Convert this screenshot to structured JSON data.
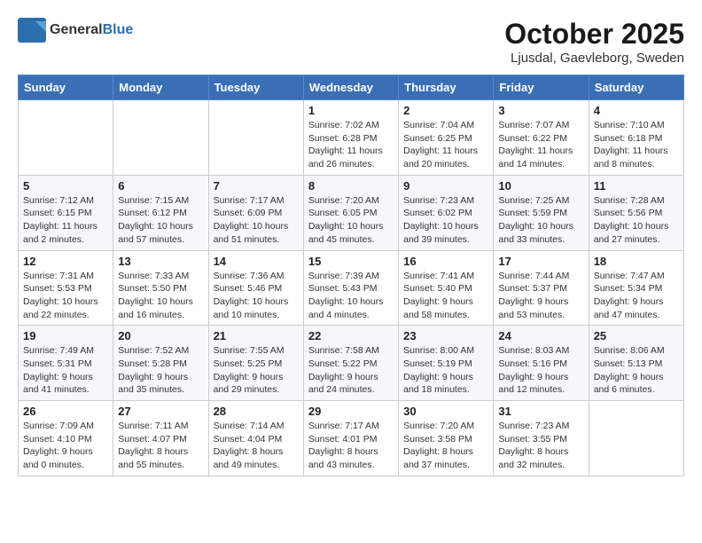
{
  "logo": {
    "general": "General",
    "blue": "Blue",
    "tagline": ""
  },
  "title": {
    "month_year": "October 2025",
    "location": "Ljusdal, Gaevleborg, Sweden"
  },
  "days_header": [
    "Sunday",
    "Monday",
    "Tuesday",
    "Wednesday",
    "Thursday",
    "Friday",
    "Saturday"
  ],
  "weeks": [
    [
      {
        "day": "",
        "content": ""
      },
      {
        "day": "",
        "content": ""
      },
      {
        "day": "",
        "content": ""
      },
      {
        "day": "1",
        "content": "Sunrise: 7:02 AM\nSunset: 6:28 PM\nDaylight: 11 hours\nand 26 minutes."
      },
      {
        "day": "2",
        "content": "Sunrise: 7:04 AM\nSunset: 6:25 PM\nDaylight: 11 hours\nand 20 minutes."
      },
      {
        "day": "3",
        "content": "Sunrise: 7:07 AM\nSunset: 6:22 PM\nDaylight: 11 hours\nand 14 minutes."
      },
      {
        "day": "4",
        "content": "Sunrise: 7:10 AM\nSunset: 6:18 PM\nDaylight: 11 hours\nand 8 minutes."
      }
    ],
    [
      {
        "day": "5",
        "content": "Sunrise: 7:12 AM\nSunset: 6:15 PM\nDaylight: 11 hours\nand 2 minutes."
      },
      {
        "day": "6",
        "content": "Sunrise: 7:15 AM\nSunset: 6:12 PM\nDaylight: 10 hours\nand 57 minutes."
      },
      {
        "day": "7",
        "content": "Sunrise: 7:17 AM\nSunset: 6:09 PM\nDaylight: 10 hours\nand 51 minutes."
      },
      {
        "day": "8",
        "content": "Sunrise: 7:20 AM\nSunset: 6:05 PM\nDaylight: 10 hours\nand 45 minutes."
      },
      {
        "day": "9",
        "content": "Sunrise: 7:23 AM\nSunset: 6:02 PM\nDaylight: 10 hours\nand 39 minutes."
      },
      {
        "day": "10",
        "content": "Sunrise: 7:25 AM\nSunset: 5:59 PM\nDaylight: 10 hours\nand 33 minutes."
      },
      {
        "day": "11",
        "content": "Sunrise: 7:28 AM\nSunset: 5:56 PM\nDaylight: 10 hours\nand 27 minutes."
      }
    ],
    [
      {
        "day": "12",
        "content": "Sunrise: 7:31 AM\nSunset: 5:53 PM\nDaylight: 10 hours\nand 22 minutes."
      },
      {
        "day": "13",
        "content": "Sunrise: 7:33 AM\nSunset: 5:50 PM\nDaylight: 10 hours\nand 16 minutes."
      },
      {
        "day": "14",
        "content": "Sunrise: 7:36 AM\nSunset: 5:46 PM\nDaylight: 10 hours\nand 10 minutes."
      },
      {
        "day": "15",
        "content": "Sunrise: 7:39 AM\nSunset: 5:43 PM\nDaylight: 10 hours\nand 4 minutes."
      },
      {
        "day": "16",
        "content": "Sunrise: 7:41 AM\nSunset: 5:40 PM\nDaylight: 9 hours\nand 58 minutes."
      },
      {
        "day": "17",
        "content": "Sunrise: 7:44 AM\nSunset: 5:37 PM\nDaylight: 9 hours\nand 53 minutes."
      },
      {
        "day": "18",
        "content": "Sunrise: 7:47 AM\nSunset: 5:34 PM\nDaylight: 9 hours\nand 47 minutes."
      }
    ],
    [
      {
        "day": "19",
        "content": "Sunrise: 7:49 AM\nSunset: 5:31 PM\nDaylight: 9 hours\nand 41 minutes."
      },
      {
        "day": "20",
        "content": "Sunrise: 7:52 AM\nSunset: 5:28 PM\nDaylight: 9 hours\nand 35 minutes."
      },
      {
        "day": "21",
        "content": "Sunrise: 7:55 AM\nSunset: 5:25 PM\nDaylight: 9 hours\nand 29 minutes."
      },
      {
        "day": "22",
        "content": "Sunrise: 7:58 AM\nSunset: 5:22 PM\nDaylight: 9 hours\nand 24 minutes."
      },
      {
        "day": "23",
        "content": "Sunrise: 8:00 AM\nSunset: 5:19 PM\nDaylight: 9 hours\nand 18 minutes."
      },
      {
        "day": "24",
        "content": "Sunrise: 8:03 AM\nSunset: 5:16 PM\nDaylight: 9 hours\nand 12 minutes."
      },
      {
        "day": "25",
        "content": "Sunrise: 8:06 AM\nSunset: 5:13 PM\nDaylight: 9 hours\nand 6 minutes."
      }
    ],
    [
      {
        "day": "26",
        "content": "Sunrise: 7:09 AM\nSunset: 4:10 PM\nDaylight: 9 hours\nand 0 minutes."
      },
      {
        "day": "27",
        "content": "Sunrise: 7:11 AM\nSunset: 4:07 PM\nDaylight: 8 hours\nand 55 minutes."
      },
      {
        "day": "28",
        "content": "Sunrise: 7:14 AM\nSunset: 4:04 PM\nDaylight: 8 hours\nand 49 minutes."
      },
      {
        "day": "29",
        "content": "Sunrise: 7:17 AM\nSunset: 4:01 PM\nDaylight: 8 hours\nand 43 minutes."
      },
      {
        "day": "30",
        "content": "Sunrise: 7:20 AM\nSunset: 3:58 PM\nDaylight: 8 hours\nand 37 minutes."
      },
      {
        "day": "31",
        "content": "Sunrise: 7:23 AM\nSunset: 3:55 PM\nDaylight: 8 hours\nand 32 minutes."
      },
      {
        "day": "",
        "content": ""
      }
    ]
  ]
}
